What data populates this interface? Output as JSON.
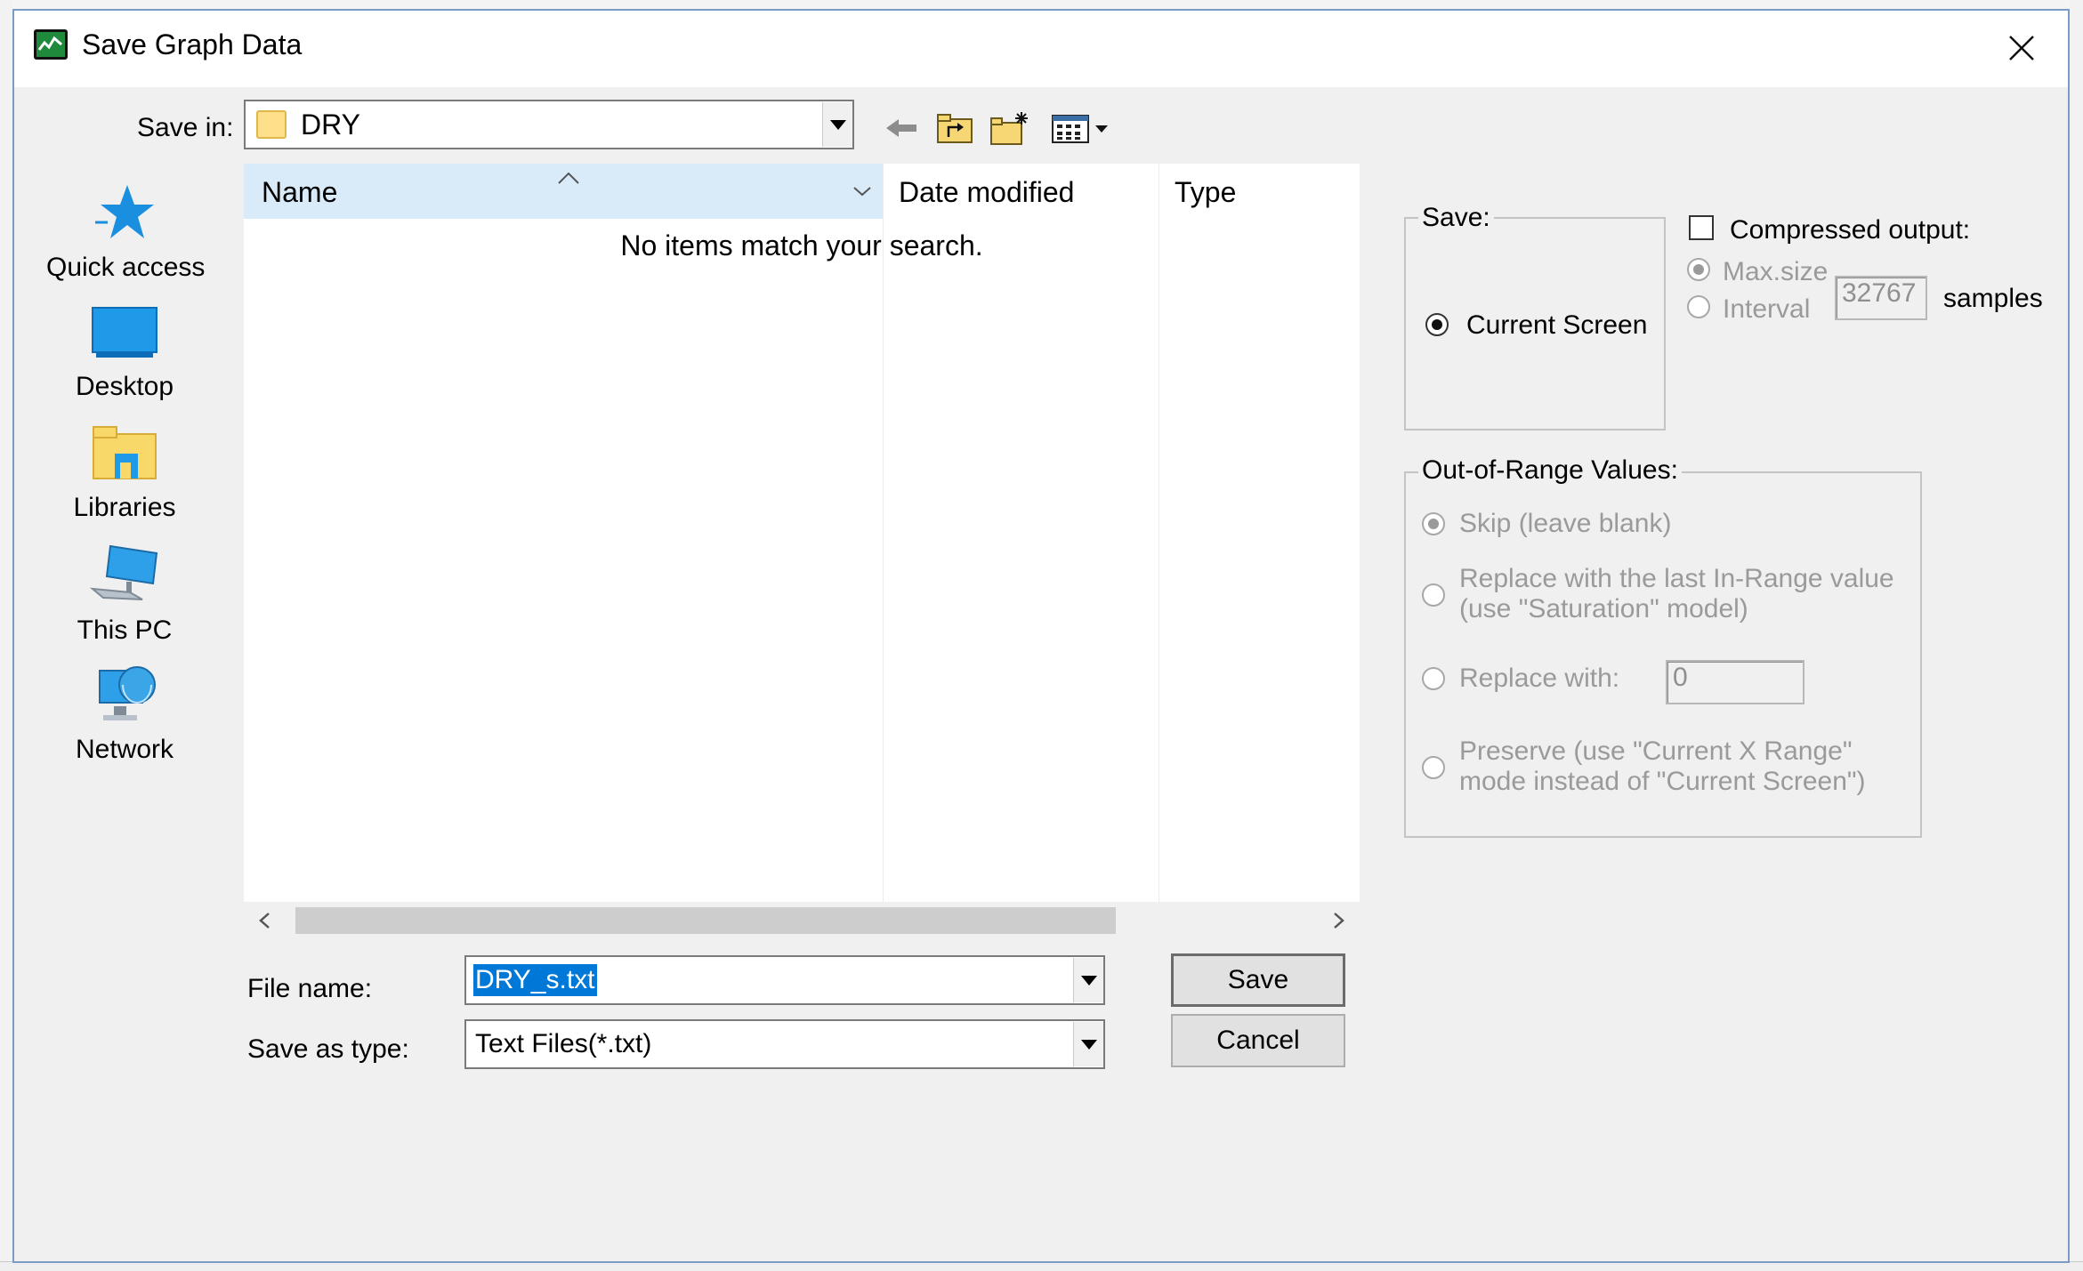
{
  "dialog": {
    "title": "Save Graph Data"
  },
  "toolbar": {
    "save_in_label": "Save in:",
    "save_in_value": "DRY",
    "icons": [
      "back-arrow-icon",
      "up-folder-icon",
      "new-folder-icon",
      "view-menu-icon"
    ]
  },
  "places": [
    {
      "label": "Quick access",
      "icon": "star-icon"
    },
    {
      "label": "Desktop",
      "icon": "desktop-icon"
    },
    {
      "label": "Libraries",
      "icon": "libraries-icon"
    },
    {
      "label": "This PC",
      "icon": "computer-icon"
    },
    {
      "label": "Network",
      "icon": "network-icon"
    }
  ],
  "file_list": {
    "columns": [
      "Name",
      "Date modified",
      "Type"
    ],
    "empty_message": "No items match your search."
  },
  "fields": {
    "file_name_label": "File name:",
    "file_name_value": "DRY_s.txt",
    "save_as_type_label": "Save as type:",
    "save_as_type_value": "Text Files(*.txt)"
  },
  "buttons": {
    "save": "Save",
    "cancel": "Cancel"
  },
  "save_group": {
    "title": "Save:",
    "current_screen": "Current Screen"
  },
  "compressed": {
    "label": "Compressed output:",
    "checked": false,
    "max_size": "Max.size",
    "interval": "Interval",
    "samples_value": "32767",
    "samples_label": "samples"
  },
  "out_of_range": {
    "title": "Out-of-Range Values:",
    "skip": "Skip (leave blank)",
    "replace_last_line1": "Replace with the last In-Range value",
    "replace_last_line2": "(use \"Saturation\" model)",
    "replace_with": "Replace with:",
    "replace_value": "0",
    "preserve_line1": "Preserve (use \"Current X Range\"",
    "preserve_line2": "mode instead of \"Current Screen\")"
  },
  "colors": {
    "selection": "#0078d7",
    "header_highlight": "#d9eaf9",
    "dialog_bg": "#f0f0f0",
    "disabled_text": "#9a9a9a"
  }
}
